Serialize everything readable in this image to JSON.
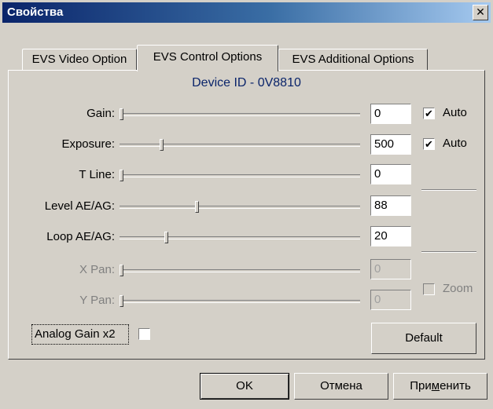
{
  "window": {
    "title": "Свойства",
    "close_glyph": "✕"
  },
  "tabs": [
    {
      "label": "EVS Video Option",
      "active": false
    },
    {
      "label": "EVS Control Options",
      "active": true
    },
    {
      "label": "EVS Additional Options",
      "active": false
    }
  ],
  "device_id": "Device ID - 0V8810",
  "controls": [
    {
      "label": "Gain:",
      "value": "0",
      "slider": 0.0,
      "enabled": true
    },
    {
      "label": "Exposure:",
      "value": "500",
      "slider": 0.17,
      "enabled": true
    },
    {
      "label": "T Line:",
      "value": "0",
      "slider": 0.0,
      "enabled": true
    },
    {
      "label": "Level AE/AG:",
      "value": "88",
      "slider": 0.32,
      "enabled": true
    },
    {
      "label": "Loop AE/AG:",
      "value": "20",
      "slider": 0.19,
      "enabled": true
    },
    {
      "label": "X Pan:",
      "value": "0",
      "slider": 0.0,
      "enabled": false
    },
    {
      "label": "Y Pan:",
      "value": "0",
      "slider": 0.0,
      "enabled": false
    }
  ],
  "auto_gain": {
    "label": "Auto",
    "checked": true
  },
  "auto_exposure": {
    "label": "Auto",
    "checked": true
  },
  "zoom": {
    "label": "Zoom",
    "checked": false,
    "enabled": false
  },
  "analog_gain": {
    "label": "Analog Gain x2",
    "checked": false
  },
  "buttons": {
    "default": "Default",
    "ok": "OK",
    "cancel": "Отмена",
    "apply_prefix": "При",
    "apply_underlined": "м",
    "apply_suffix": "енить"
  },
  "colors": {
    "title_start": "#0a246a",
    "title_end": "#a6caf0",
    "face": "#d4d0c8",
    "device_id_text": "#0a246a"
  }
}
